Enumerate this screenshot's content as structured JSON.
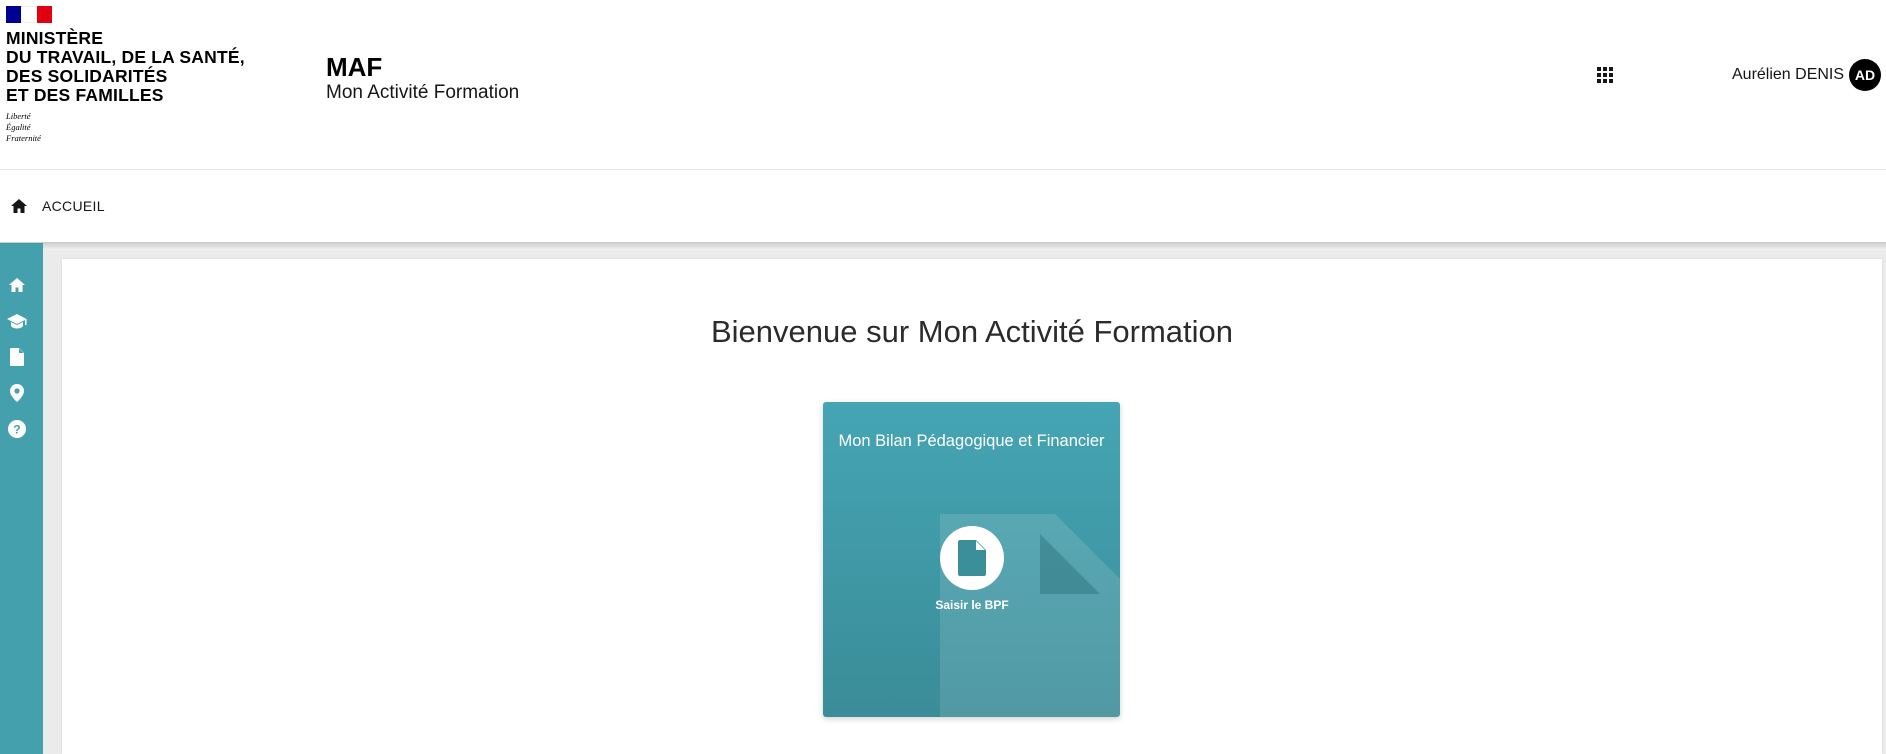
{
  "header": {
    "ministry_lines": [
      "MINISTÈRE",
      "DU TRAVAIL, DE LA SANTÉ,",
      "DES SOLIDARITÉS",
      "ET DES FAMILLES"
    ],
    "motto_lines": [
      "Liberté",
      "Égalité",
      "Fraternité"
    ],
    "service_title": "MAF",
    "service_tagline": "Mon Activité Formation",
    "apps_icon": "grid-icon",
    "user_name": "Aurélien DENIS",
    "user_initials": "AD"
  },
  "breadcrumb": {
    "home_icon": "home-icon",
    "label": "ACCUEIL"
  },
  "sidebar": {
    "items": [
      {
        "icon": "home-icon"
      },
      {
        "icon": "graduation-cap-icon"
      },
      {
        "icon": "document-icon"
      },
      {
        "icon": "map-marker-icon"
      },
      {
        "icon": "help-icon"
      }
    ]
  },
  "main": {
    "welcome_title": "Bienvenue sur Mon Activité Formation",
    "card": {
      "title": "Mon Bilan Pédagogique et Financier",
      "action_icon": "document-icon",
      "action_label": "Saisir le BPF"
    }
  },
  "colors": {
    "accent": "#45a0ae",
    "card_top": "#45a5b4",
    "card_bottom": "#3a8c98",
    "flag_blue": "#000091",
    "flag_red": "#e1000f"
  }
}
